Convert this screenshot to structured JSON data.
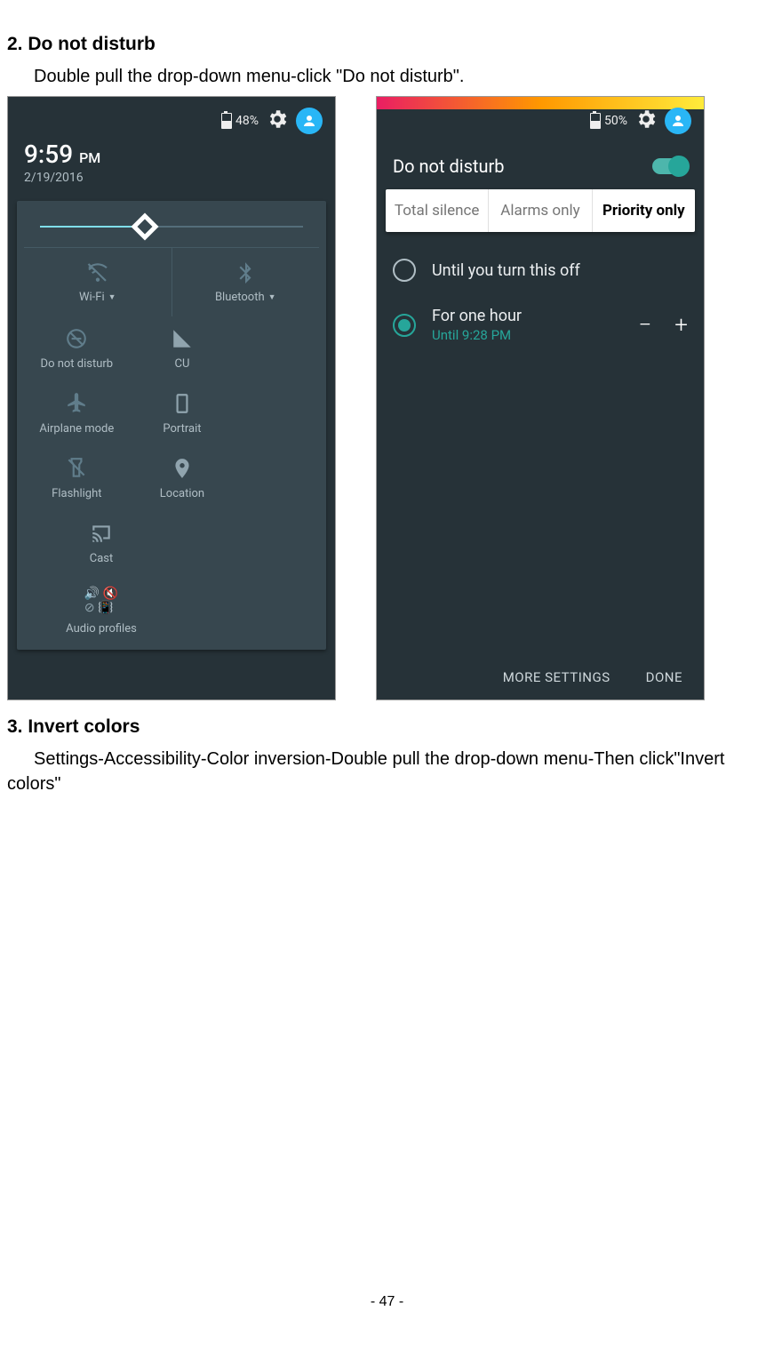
{
  "section2": {
    "heading": "2. Do not disturb",
    "text": "Double pull the drop-down menu-click \"Do not disturb\"."
  },
  "section3": {
    "heading": "3. Invert colors",
    "text": "Settings-Accessibility-Color inversion-Double pull the drop-down menu-Then    click\"Invert colors\""
  },
  "page_number": "- 47 -",
  "left_phone": {
    "battery": "48%",
    "time": "9:59",
    "ampm": "PM",
    "date": "2/19/2016",
    "tiles": {
      "wifi": "Wi-Fi",
      "bluetooth": "Bluetooth",
      "dnd": "Do not disturb",
      "cu": "CU",
      "airplane": "Airplane mode",
      "portrait": "Portrait",
      "flashlight": "Flashlight",
      "location": "Location",
      "cast": "Cast",
      "audio": "Audio profiles"
    }
  },
  "right_phone": {
    "battery": "50%",
    "title": "Do not disturb",
    "tabs": {
      "total": "Total silence",
      "alarms": "Alarms only",
      "priority": "Priority only"
    },
    "opts": {
      "until_off": "Until you turn this off",
      "for_hour": "For one hour",
      "for_hour_sub": "Until 9:28 PM",
      "minus": "−",
      "plus": "+"
    },
    "actions": {
      "more": "MORE SETTINGS",
      "done": "DONE"
    }
  }
}
